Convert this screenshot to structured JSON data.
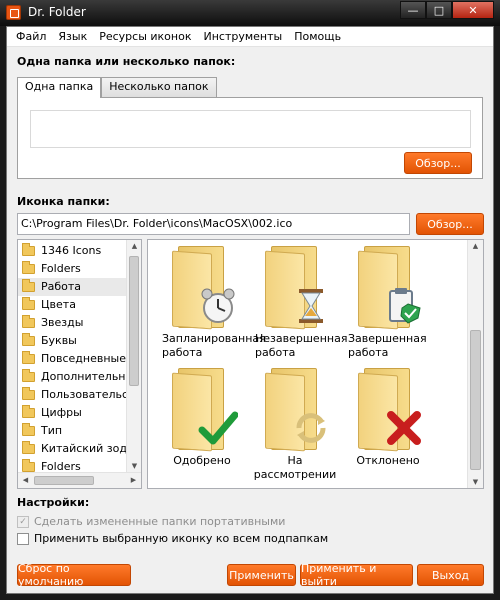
{
  "window": {
    "title": "Dr. Folder"
  },
  "menu": [
    "Файл",
    "Язык",
    "Ресурсы иконок",
    "Инструменты",
    "Помощь"
  ],
  "folders_section": {
    "title": "Одна папка или несколько папок:",
    "tabs": [
      "Одна папка",
      "Несколько папок"
    ],
    "active_tab": "Одна папка",
    "browse_label": "Обзор..."
  },
  "icon_section": {
    "title": "Иконка папки:",
    "path_value": "C:\\Program Files\\Dr. Folder\\icons\\MacOSX\\002.ico",
    "browse_label": "Обзор..."
  },
  "tree": {
    "items": [
      "1346 Icons",
      "Folders",
      "Работа",
      "Цвета",
      "Звезды",
      "Буквы",
      "Повседневные",
      "Дополнительные",
      "Пользовательские",
      "Цифры",
      "Тип",
      "Китайский зодиак",
      "Folders"
    ],
    "selected": "Работа"
  },
  "icons": [
    {
      "label": "Запланированная работа",
      "badge": "alarm-clock-icon"
    },
    {
      "label": "Незавершенная работа",
      "badge": "hourglass-icon"
    },
    {
      "label": "Завершенная работа",
      "badge": "clipboard-check-icon"
    },
    {
      "label": "Одобрено",
      "badge": "green-check-icon"
    },
    {
      "label": "На рассмотрении",
      "badge": "refresh-arrows-icon"
    },
    {
      "label": "Отклонено",
      "badge": "red-x-icon"
    }
  ],
  "settings": {
    "title": "Настройки:",
    "portable_label": "Сделать измененные папки портативными",
    "portable_checked": true,
    "portable_disabled": true,
    "apply_sub_label": "Применить выбранную иконку ко всем подпапкам",
    "apply_sub_checked": false
  },
  "buttons": {
    "reset": "Сброс по умолчанию",
    "apply": "Применить",
    "apply_exit": "Применить и выйти",
    "exit": "Выход"
  },
  "colors": {
    "accent": "#f26a18",
    "folder": "#f5d685",
    "titlebar": "#111111"
  }
}
